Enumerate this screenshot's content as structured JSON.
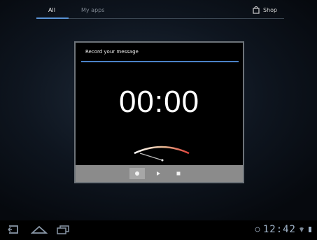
{
  "top_bar": {
    "tabs": [
      {
        "label": "All",
        "selected": true
      },
      {
        "label": "My apps",
        "selected": false
      }
    ],
    "shop_label": "Shop",
    "shop_icon": "shopping-bag-icon"
  },
  "dialog": {
    "title": "Record your message",
    "timer": "00:00",
    "controls": [
      {
        "name": "record",
        "icon": "record-icon"
      },
      {
        "name": "play",
        "icon": "play-icon"
      },
      {
        "name": "stop",
        "icon": "stop-icon"
      }
    ]
  },
  "system_bar": {
    "nav_icons": [
      "back-icon",
      "home-icon",
      "recents-icon"
    ],
    "clock": "12:42"
  },
  "colors": {
    "accent": "#4b82c8",
    "control_bar": "#8b8b8b",
    "vu_start": "#ffffff",
    "vu_end": "#e0413a"
  }
}
